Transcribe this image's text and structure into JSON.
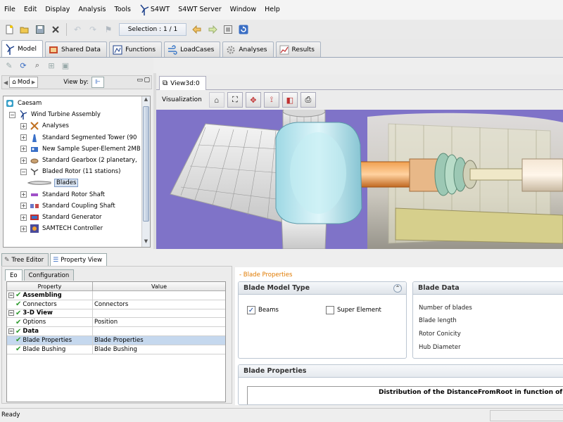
{
  "menubar": {
    "items": [
      "File",
      "Edit",
      "Display",
      "Analysis",
      "Tools",
      "S4WT",
      "S4WT Server",
      "Window",
      "Help"
    ]
  },
  "toolbar": {
    "selection_label": "Selection : 1 / 1",
    "icons": [
      "new-icon",
      "open-icon",
      "save-icon",
      "delete-icon",
      "undo-icon",
      "redo-icon",
      "run-icon",
      "back-arrow-icon",
      "forward-arrow-icon",
      "list-icon",
      "refresh-icon"
    ]
  },
  "perspectives": {
    "tabs": [
      {
        "label": "Model",
        "icon": "turbine-icon",
        "active": true
      },
      {
        "label": "Shared Data",
        "icon": "shared-data-icon",
        "active": false
      },
      {
        "label": "Functions",
        "icon": "function-icon",
        "active": false
      },
      {
        "label": "LoadCases",
        "icon": "wind-icon",
        "active": false
      },
      {
        "label": "Analyses",
        "icon": "gear-icon",
        "active": false
      },
      {
        "label": "Results",
        "icon": "chart-icon",
        "active": false
      }
    ]
  },
  "tree_panel": {
    "tab_label": "Mod",
    "view_by_label": "View by:",
    "nodes": [
      {
        "label": "Caesam",
        "level": 0,
        "expander": "",
        "icon": "caesam-icon"
      },
      {
        "label": "Wind Turbine Assembly",
        "level": 1,
        "expander": "−",
        "icon": "turbine-icon"
      },
      {
        "label": "Analyses",
        "level": 2,
        "expander": "+",
        "icon": "analyses-icon"
      },
      {
        "label": "Standard Segmented Tower (90",
        "level": 2,
        "expander": "+",
        "icon": "tower-icon"
      },
      {
        "label": "New Sample Super-Element 2MB",
        "level": 2,
        "expander": "+",
        "icon": "super-element-icon"
      },
      {
        "label": "Standard Gearbox (2 planetary,",
        "level": 2,
        "expander": "+",
        "icon": "gearbox-icon"
      },
      {
        "label": "Bladed Rotor (11 stations)",
        "level": 2,
        "expander": "−",
        "icon": "rotor-icon"
      },
      {
        "label": "Blades",
        "level": 3,
        "expander": "",
        "icon": "blade-icon",
        "selected": true
      },
      {
        "label": "Standard Rotor Shaft",
        "level": 2,
        "expander": "+",
        "icon": "shaft-icon"
      },
      {
        "label": "Standard Coupling Shaft",
        "level": 2,
        "expander": "+",
        "icon": "coupling-icon"
      },
      {
        "label": "Standard Generator",
        "level": 2,
        "expander": "+",
        "icon": "generator-icon"
      },
      {
        "label": "SAMTECH Controller",
        "level": 2,
        "expander": "+",
        "icon": "controller-icon"
      }
    ]
  },
  "view3d": {
    "tab_label": "View3d:0",
    "visualization_label": "Visualization",
    "colors": {
      "background": "#7f73c8",
      "nacelle": "#e8e6d6",
      "hub": "#b8e6ec",
      "shaft": "#e08a3a"
    }
  },
  "bottom_left": {
    "tabs": [
      {
        "label": "Tree Editor",
        "active": false
      },
      {
        "label": "Property View",
        "active": true
      }
    ],
    "subtabs": [
      {
        "label": "Eo",
        "active": true
      },
      {
        "label": "Configuration",
        "active": false
      }
    ],
    "table": {
      "headers": [
        "Property",
        "Value"
      ],
      "rows": [
        {
          "property": "Assembling",
          "value": "",
          "group": true
        },
        {
          "property": "Connectors",
          "value": "Connectors",
          "group": false
        },
        {
          "property": "3-D View",
          "value": "",
          "group": true
        },
        {
          "property": "Options",
          "value": "Position",
          "group": false
        },
        {
          "property": "Data",
          "value": "",
          "group": true
        },
        {
          "property": "Blade Properties",
          "value": "Blade Properties",
          "group": false,
          "selected": true
        },
        {
          "property": "Blade Bushing",
          "value": "Blade Bushing",
          "group": false
        }
      ]
    }
  },
  "bottom_right": {
    "header": "- Blade Properties",
    "blade_model_type": {
      "title": "Blade Model Type",
      "options": [
        {
          "label": "Beams",
          "checked": true
        },
        {
          "label": "Super Element",
          "checked": false
        }
      ]
    },
    "blade_data": {
      "title": "Blade Data",
      "fields": [
        "Number of blades",
        "Blade length",
        "Rotor Conicity",
        "Hub Diameter"
      ]
    },
    "blade_properties": {
      "title": "Blade Properties",
      "chart_title": "Distribution of the DistanceFromRoot in function of the Dist"
    }
  },
  "status": {
    "text": "Ready"
  }
}
